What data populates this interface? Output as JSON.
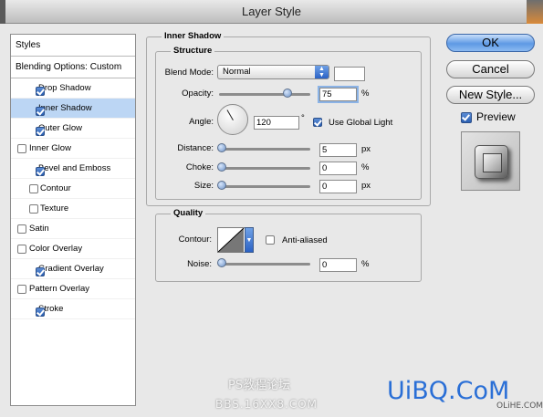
{
  "window": {
    "title": "Layer Style"
  },
  "styles_list": {
    "header": "Styles",
    "blending": "Blending Options: Custom",
    "items": [
      {
        "label": "Drop Shadow",
        "checked": true,
        "indent": false,
        "selected": false
      },
      {
        "label": "Inner Shadow",
        "checked": true,
        "indent": false,
        "selected": true
      },
      {
        "label": "Outer Glow",
        "checked": true,
        "indent": false,
        "selected": false
      },
      {
        "label": "Inner Glow",
        "checked": false,
        "indent": false,
        "selected": false
      },
      {
        "label": "Bevel and Emboss",
        "checked": true,
        "indent": false,
        "selected": false
      },
      {
        "label": "Contour",
        "checked": false,
        "indent": true,
        "selected": false
      },
      {
        "label": "Texture",
        "checked": false,
        "indent": true,
        "selected": false
      },
      {
        "label": "Satin",
        "checked": false,
        "indent": false,
        "selected": false
      },
      {
        "label": "Color Overlay",
        "checked": false,
        "indent": false,
        "selected": false
      },
      {
        "label": "Gradient Overlay",
        "checked": true,
        "indent": false,
        "selected": false
      },
      {
        "label": "Pattern Overlay",
        "checked": false,
        "indent": false,
        "selected": false
      },
      {
        "label": "Stroke",
        "checked": true,
        "indent": false,
        "selected": false
      }
    ]
  },
  "inner_shadow": {
    "title": "Inner Shadow",
    "structure_title": "Structure",
    "blend_mode_label": "Blend Mode:",
    "blend_mode_value": "Normal",
    "opacity_label": "Opacity:",
    "opacity_value": "75",
    "opacity_unit": "%",
    "opacity_level": 0.75,
    "angle_label": "Angle:",
    "angle_value": "120",
    "angle_unit": "°",
    "use_global_light_label": "Use Global Light",
    "use_global_light_checked": true,
    "distance_label": "Distance:",
    "distance_value": "5",
    "distance_unit": "px",
    "choke_label": "Choke:",
    "choke_value": "0",
    "choke_unit": "%",
    "size_label": "Size:",
    "size_value": "0",
    "size_unit": "px"
  },
  "quality": {
    "title": "Quality",
    "contour_label": "Contour:",
    "anti_aliased_label": "Anti-aliased",
    "anti_aliased_checked": false,
    "noise_label": "Noise:",
    "noise_value": "0",
    "noise_unit": "%"
  },
  "buttons": {
    "ok": "OK",
    "cancel": "Cancel",
    "new_style": "New Style...",
    "preview_label": "Preview",
    "preview_checked": true
  },
  "watermarks": {
    "ps_forum": "PS教程论坛",
    "bbs": "BBS.16XX8.COM",
    "uibq": "UiBQ.CoM",
    "olihe": "OLiHE.COM"
  },
  "colors": {
    "accent": "#3b78d8",
    "selection": "#bcd6f4",
    "watermark_red": "#e02020",
    "watermark_blue": "#2a6fd6"
  }
}
